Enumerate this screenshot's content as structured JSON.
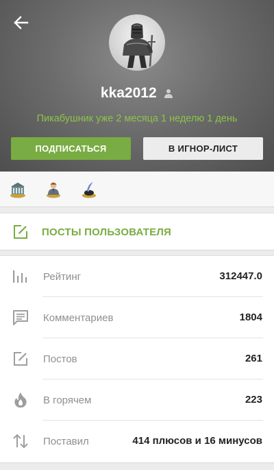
{
  "profile": {
    "username": "kka2012",
    "since_text": "Пикабушник уже 2 месяца 1 неделю 1 день",
    "subscribe_label": "ПОДПИСАТЬСЯ",
    "ignore_label": "В ИГНОР-ЛИСТ"
  },
  "awards": [
    "bank-award-icon",
    "businessman-award-icon",
    "quill-award-icon"
  ],
  "posts_link": {
    "label": "ПОСТЫ ПОЛЬЗОВАТЕЛЯ"
  },
  "stats": [
    {
      "icon": "bar-chart-icon",
      "label": "Рейтинг",
      "value": "312447.0"
    },
    {
      "icon": "comment-icon",
      "label": "Комментариев",
      "value": "1804"
    },
    {
      "icon": "edit-icon",
      "label": "Постов",
      "value": "261"
    },
    {
      "icon": "fire-icon",
      "label": "В горячем",
      "value": "223"
    },
    {
      "icon": "up-down-arrows-icon",
      "label": "Поставил",
      "value": "414 плюсов и 16 минусов"
    }
  ],
  "colors": {
    "accent_green": "#79ac42",
    "since_green": "#8cc34a",
    "header_gray": "#6c6c6c",
    "icon_gray": "#9e9e9e"
  }
}
